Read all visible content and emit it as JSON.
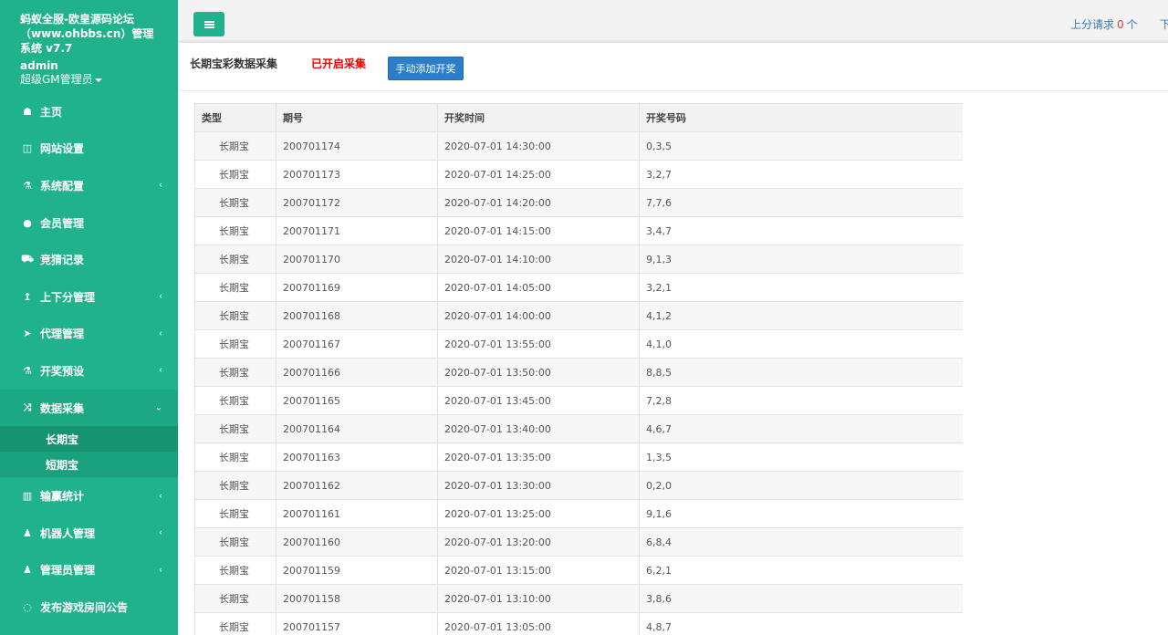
{
  "sidebar": {
    "title": "蚂蚁全服-欧皇源码论坛（www.ohbbs.cn）管理系统 v7.7",
    "username": "admin",
    "role": "超级GM管理员",
    "menu": [
      {
        "label": "主页",
        "icon": "home-icon",
        "glyph": "☗"
      },
      {
        "label": "网站设置",
        "icon": "columns-icon",
        "glyph": "◫"
      },
      {
        "label": "系统配置",
        "icon": "flask-icon",
        "glyph": "⚗",
        "chevron": "‹"
      },
      {
        "label": "会员管理",
        "icon": "user-icon",
        "glyph": "●"
      },
      {
        "label": "竞猜记录",
        "icon": "car-icon",
        "glyph": "⛟"
      },
      {
        "label": "上下分管理",
        "icon": "level-up-icon",
        "glyph": "↥",
        "chevron": "‹"
      },
      {
        "label": "代理管理",
        "icon": "paper-plane-icon",
        "glyph": "➤",
        "chevron": "‹"
      },
      {
        "label": "开奖预设",
        "icon": "flask-icon",
        "glyph": "⚗",
        "chevron": "‹"
      },
      {
        "label": "数据采集",
        "icon": "random-icon",
        "glyph": "⤨",
        "chevron": "⌄"
      },
      {
        "label": "输赢统计",
        "icon": "bar-chart-icon",
        "glyph": "▥",
        "chevron": "‹"
      },
      {
        "label": "机器人管理",
        "icon": "male-icon",
        "glyph": "♟",
        "chevron": "‹"
      },
      {
        "label": "管理员管理",
        "icon": "male-icon",
        "glyph": "♟",
        "chevron": "‹"
      },
      {
        "label": "发布游戏房间公告",
        "icon": "comment-icon",
        "glyph": "◌"
      }
    ],
    "submenu": [
      "长期宝",
      "短期宝"
    ]
  },
  "header": {
    "pending_label": "上分请求",
    "pending_count": "0",
    "pending_unit": "个",
    "next_label": "下"
  },
  "toolbar": {
    "title": "长期宝彩数据采集",
    "status": "已开启采集",
    "button": "手动添加开奖"
  },
  "table": {
    "columns": [
      "类型",
      "期号",
      "开奖时间",
      "开奖号码"
    ],
    "rows": [
      [
        "长期宝",
        "200701174",
        "2020-07-01 14:30:00",
        "0,3,5"
      ],
      [
        "长期宝",
        "200701173",
        "2020-07-01 14:25:00",
        "3,2,7"
      ],
      [
        "长期宝",
        "200701172",
        "2020-07-01 14:20:00",
        "7,7,6"
      ],
      [
        "长期宝",
        "200701171",
        "2020-07-01 14:15:00",
        "3,4,7"
      ],
      [
        "长期宝",
        "200701170",
        "2020-07-01 14:10:00",
        "9,1,3"
      ],
      [
        "长期宝",
        "200701169",
        "2020-07-01 14:05:00",
        "3,2,1"
      ],
      [
        "长期宝",
        "200701168",
        "2020-07-01 14:00:00",
        "4,1,2"
      ],
      [
        "长期宝",
        "200701167",
        "2020-07-01 13:55:00",
        "4,1,0"
      ],
      [
        "长期宝",
        "200701166",
        "2020-07-01 13:50:00",
        "8,8,5"
      ],
      [
        "长期宝",
        "200701165",
        "2020-07-01 13:45:00",
        "7,2,8"
      ],
      [
        "长期宝",
        "200701164",
        "2020-07-01 13:40:00",
        "4,6,7"
      ],
      [
        "长期宝",
        "200701163",
        "2020-07-01 13:35:00",
        "1,3,5"
      ],
      [
        "长期宝",
        "200701162",
        "2020-07-01 13:30:00",
        "0,2,0"
      ],
      [
        "长期宝",
        "200701161",
        "2020-07-01 13:25:00",
        "9,1,6"
      ],
      [
        "长期宝",
        "200701160",
        "2020-07-01 13:20:00",
        "6,8,4"
      ],
      [
        "长期宝",
        "200701159",
        "2020-07-01 13:15:00",
        "6,2,1"
      ],
      [
        "长期宝",
        "200701158",
        "2020-07-01 13:10:00",
        "3,8,6"
      ],
      [
        "长期宝",
        "200701157",
        "2020-07-01 13:05:00",
        "4,8,7"
      ]
    ]
  }
}
